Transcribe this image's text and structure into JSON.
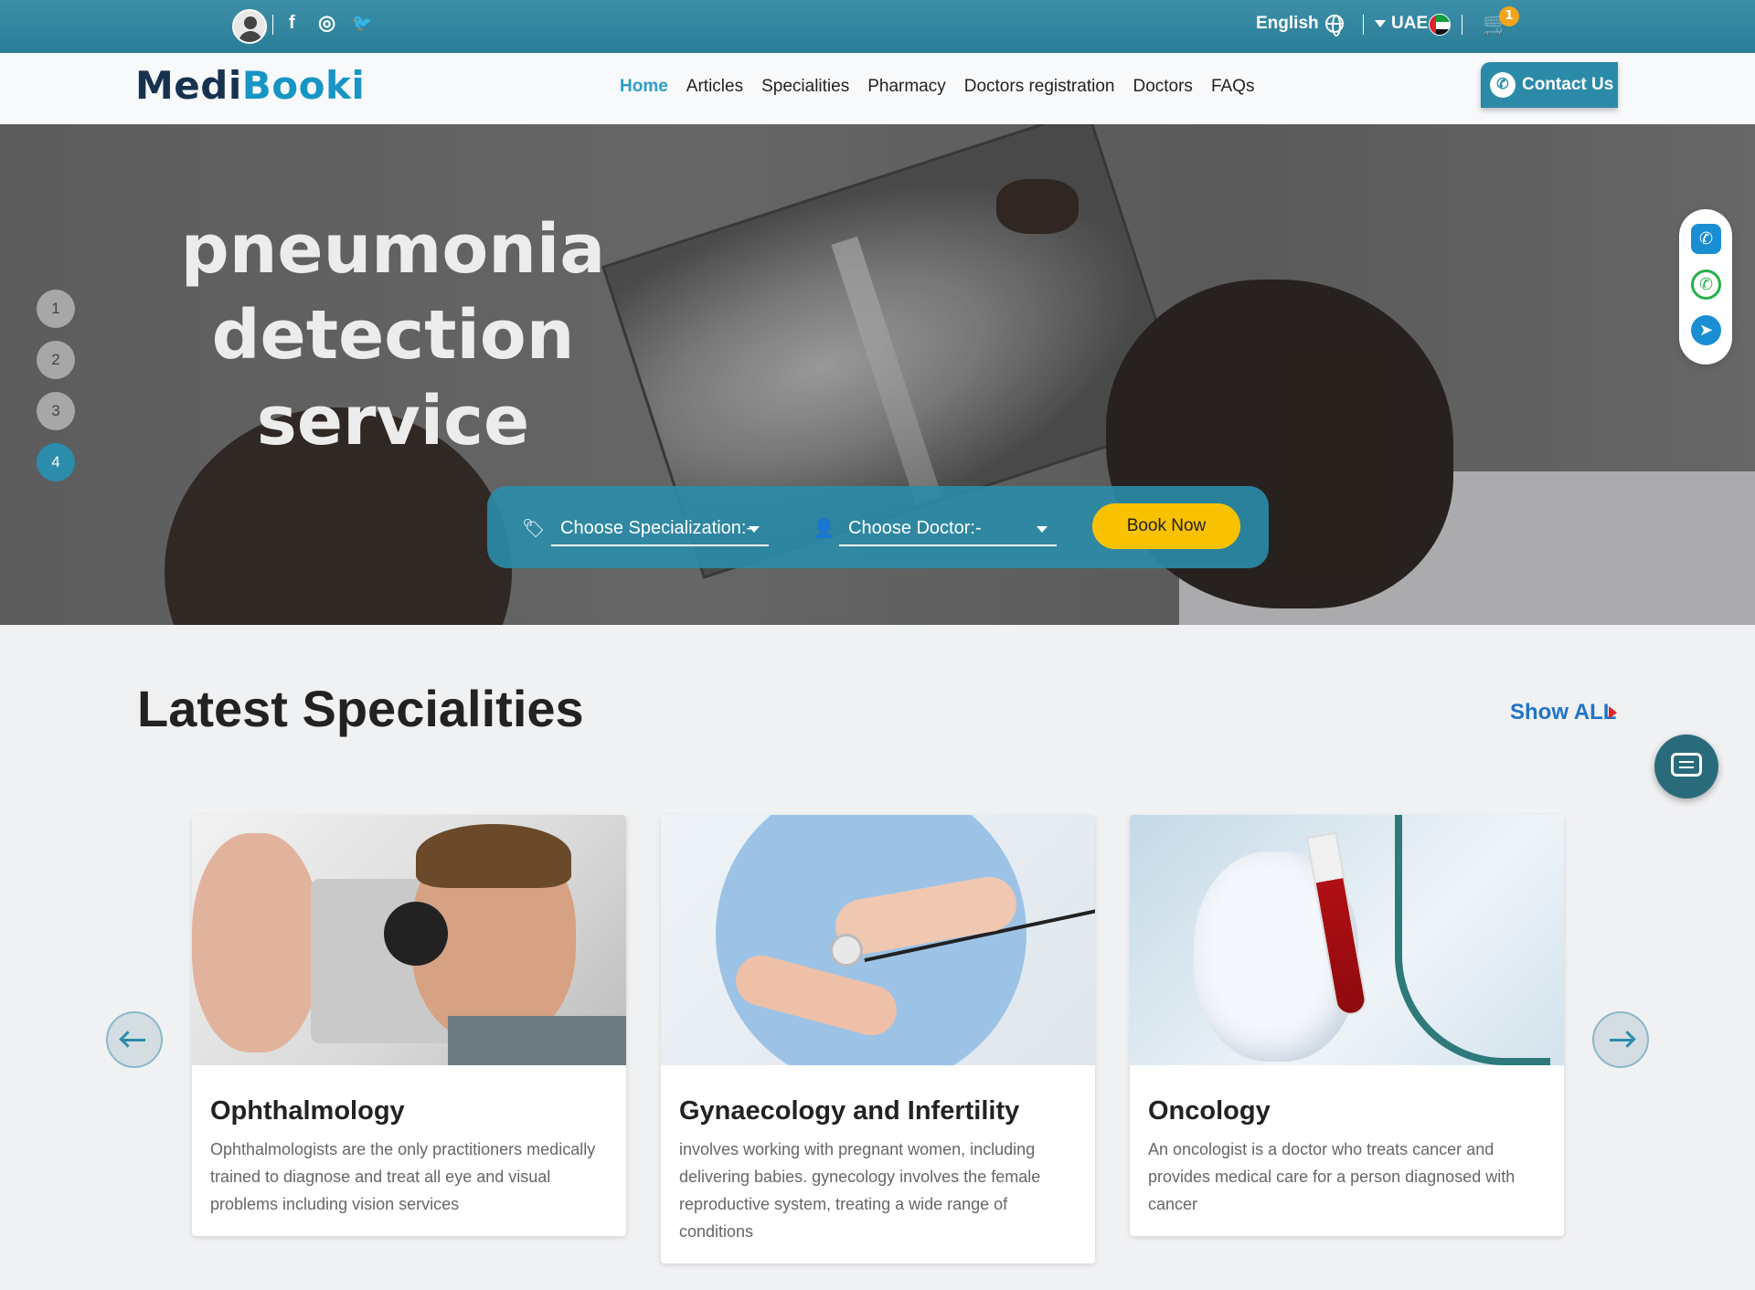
{
  "topbar": {
    "social": [
      {
        "icon": "facebook-icon",
        "glyph": "f"
      },
      {
        "icon": "instagram-icon",
        "glyph": "◎"
      },
      {
        "icon": "twitter-icon",
        "glyph": "🐦"
      }
    ],
    "language": "English",
    "country": "UAE",
    "cart_count": "1",
    "colors": {
      "bar": "#2a7d97",
      "badge": "#f5a31a"
    }
  },
  "navbar": {
    "logo_part1": "Medi",
    "logo_part2": "Booki",
    "items": [
      {
        "label": "Home",
        "active": true
      },
      {
        "label": "Articles"
      },
      {
        "label": "Specialities"
      },
      {
        "label": "Pharmacy"
      },
      {
        "label": "Doctors registration"
      },
      {
        "label": "Doctors"
      },
      {
        "label": "FAQs"
      }
    ],
    "contact_label": "Contact Us"
  },
  "hero": {
    "title_line1": "pneumonia",
    "title_line2": "detection service",
    "slides": [
      "1",
      "2",
      "3",
      "4"
    ],
    "active_slide": 4,
    "booking": {
      "specialization_placeholder": "Choose Specialization:-",
      "doctor_placeholder": "Choose Doctor:-",
      "book_label": "Book Now"
    }
  },
  "floating_social": [
    "phone-icon",
    "whatsapp-icon",
    "telegram-icon"
  ],
  "specialities": {
    "title": "Latest Specialities",
    "show_all": "Show ALL",
    "cards": [
      {
        "title": "Ophthalmology",
        "description": "Ophthalmologists are the only practitioners medically trained to diagnose and treat all eye and visual problems including vision services"
      },
      {
        "title": "Gynaecology and Infertility",
        "description": "involves working with pregnant women, including delivering babies. gynecology involves the female reproductive system, treating a wide range of conditions"
      },
      {
        "title": "Oncology",
        "description": "An oncologist is a doctor who treats cancer and provides medical care for a person diagnosed with cancer"
      }
    ]
  }
}
